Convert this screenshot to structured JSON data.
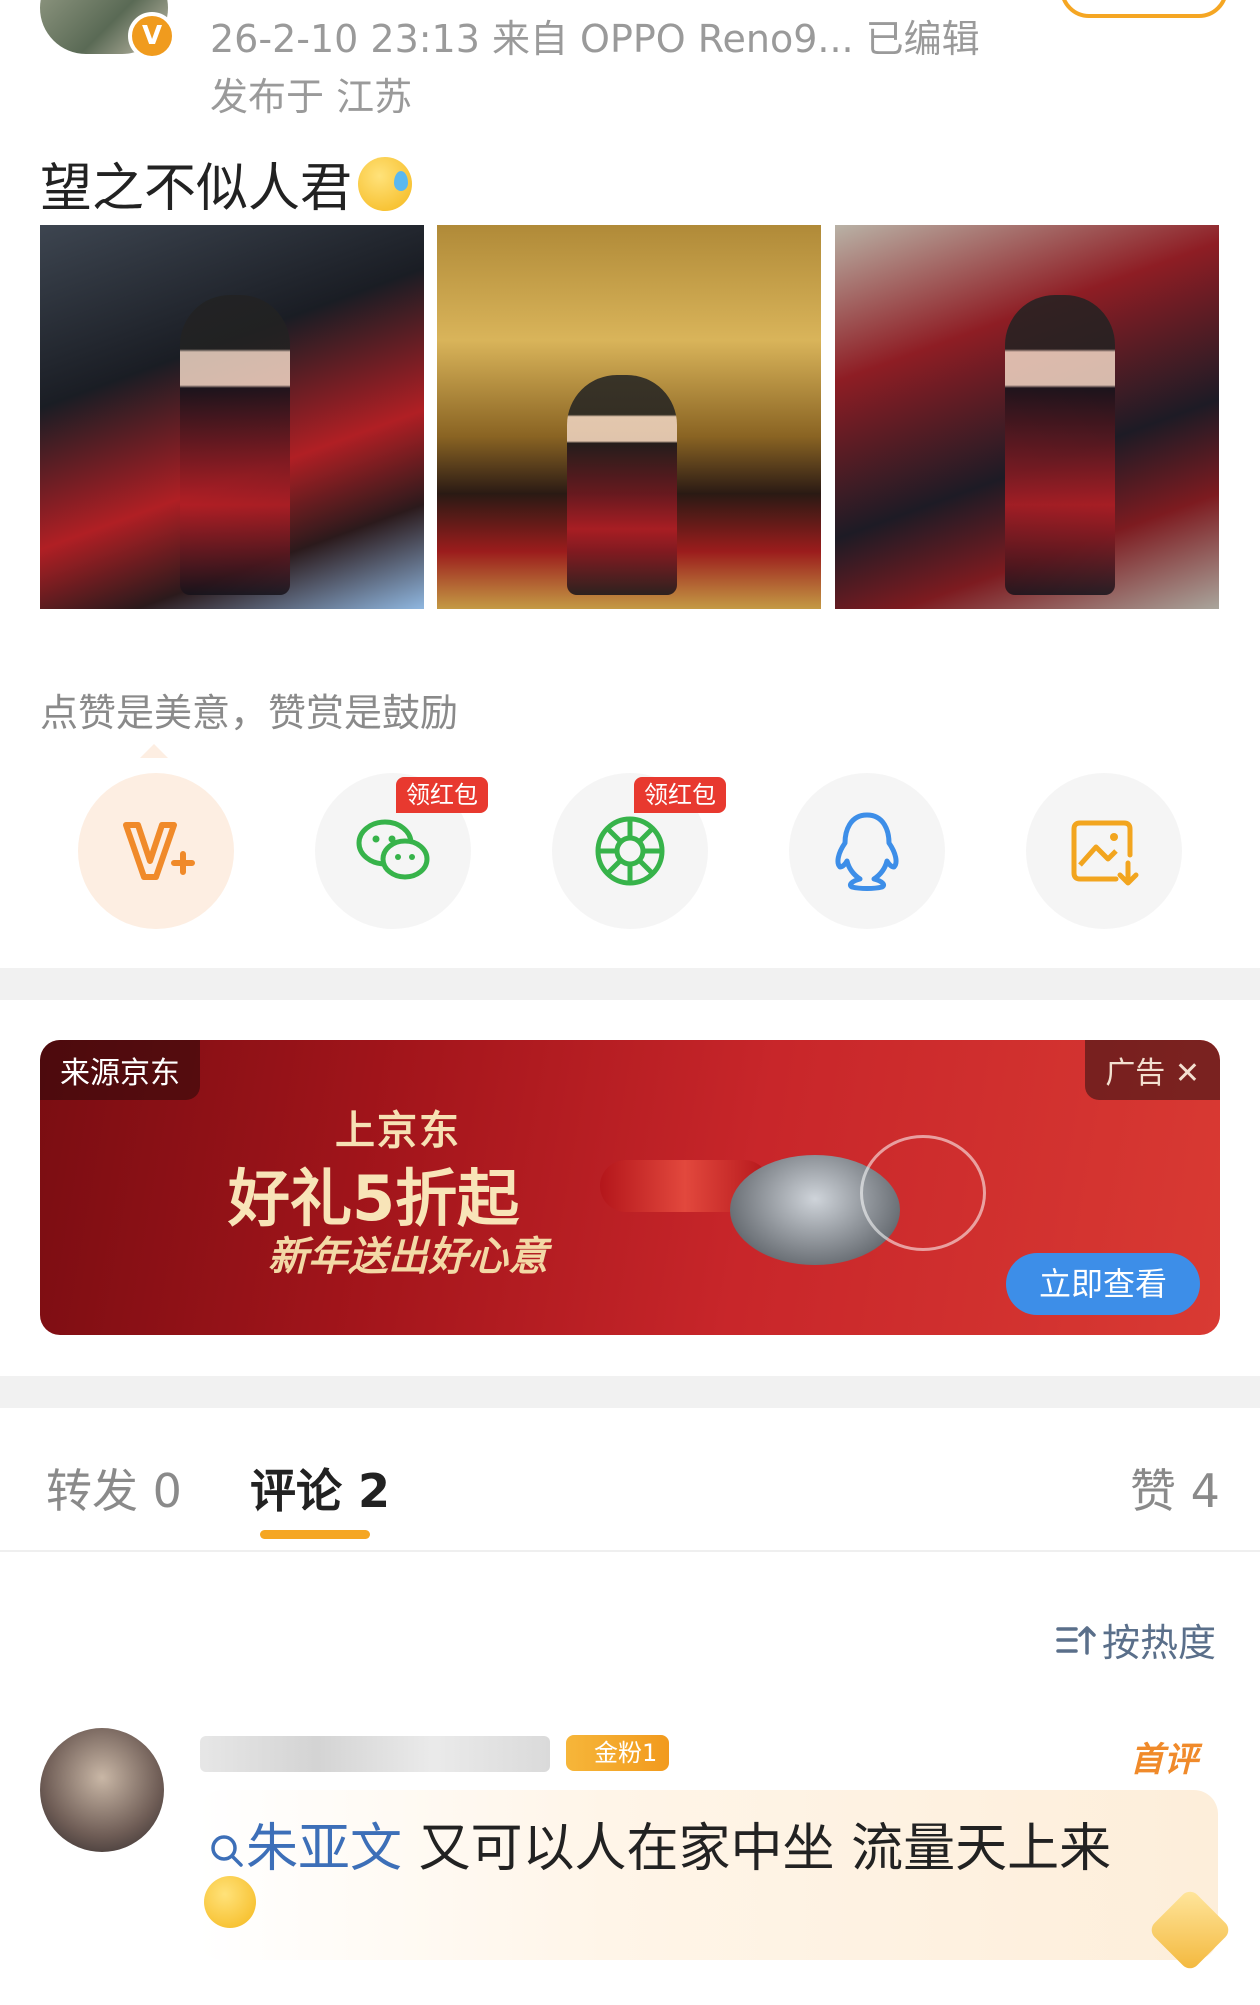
{
  "post": {
    "meta_line": "26-2-10 23:13  来自 OPPO Reno9...  已编辑",
    "location": "发布于 江苏",
    "badge_letter": "V",
    "text": "望之不似人君"
  },
  "reward": {
    "label": "点赞是美意，赞赏是鼓励"
  },
  "share": {
    "red_packet_label": "领红包",
    "items": [
      "reward-icon",
      "wechat-icon",
      "moments-icon",
      "qq-icon",
      "save-image-icon"
    ]
  },
  "ad": {
    "source": "来源京东",
    "tag": "广告 ✕",
    "line1": "上京东",
    "line2": "好礼5折起",
    "line3": "新年送出好心意",
    "button": "立即查看"
  },
  "tabs": {
    "repost": "转发 0",
    "comment": "评论 2",
    "like": "赞 4"
  },
  "sort": {
    "label": "按热度"
  },
  "comment": {
    "fan_badge": "金粉1",
    "first_label": "首评",
    "mention": "朱亚文",
    "text": " 又可以人在家中坐 流量天上来"
  },
  "colors": {
    "accent": "#f5a623",
    "red_tag": "#e8392f",
    "link": "#3d6fb8",
    "ad_button": "#3d8ee8"
  }
}
